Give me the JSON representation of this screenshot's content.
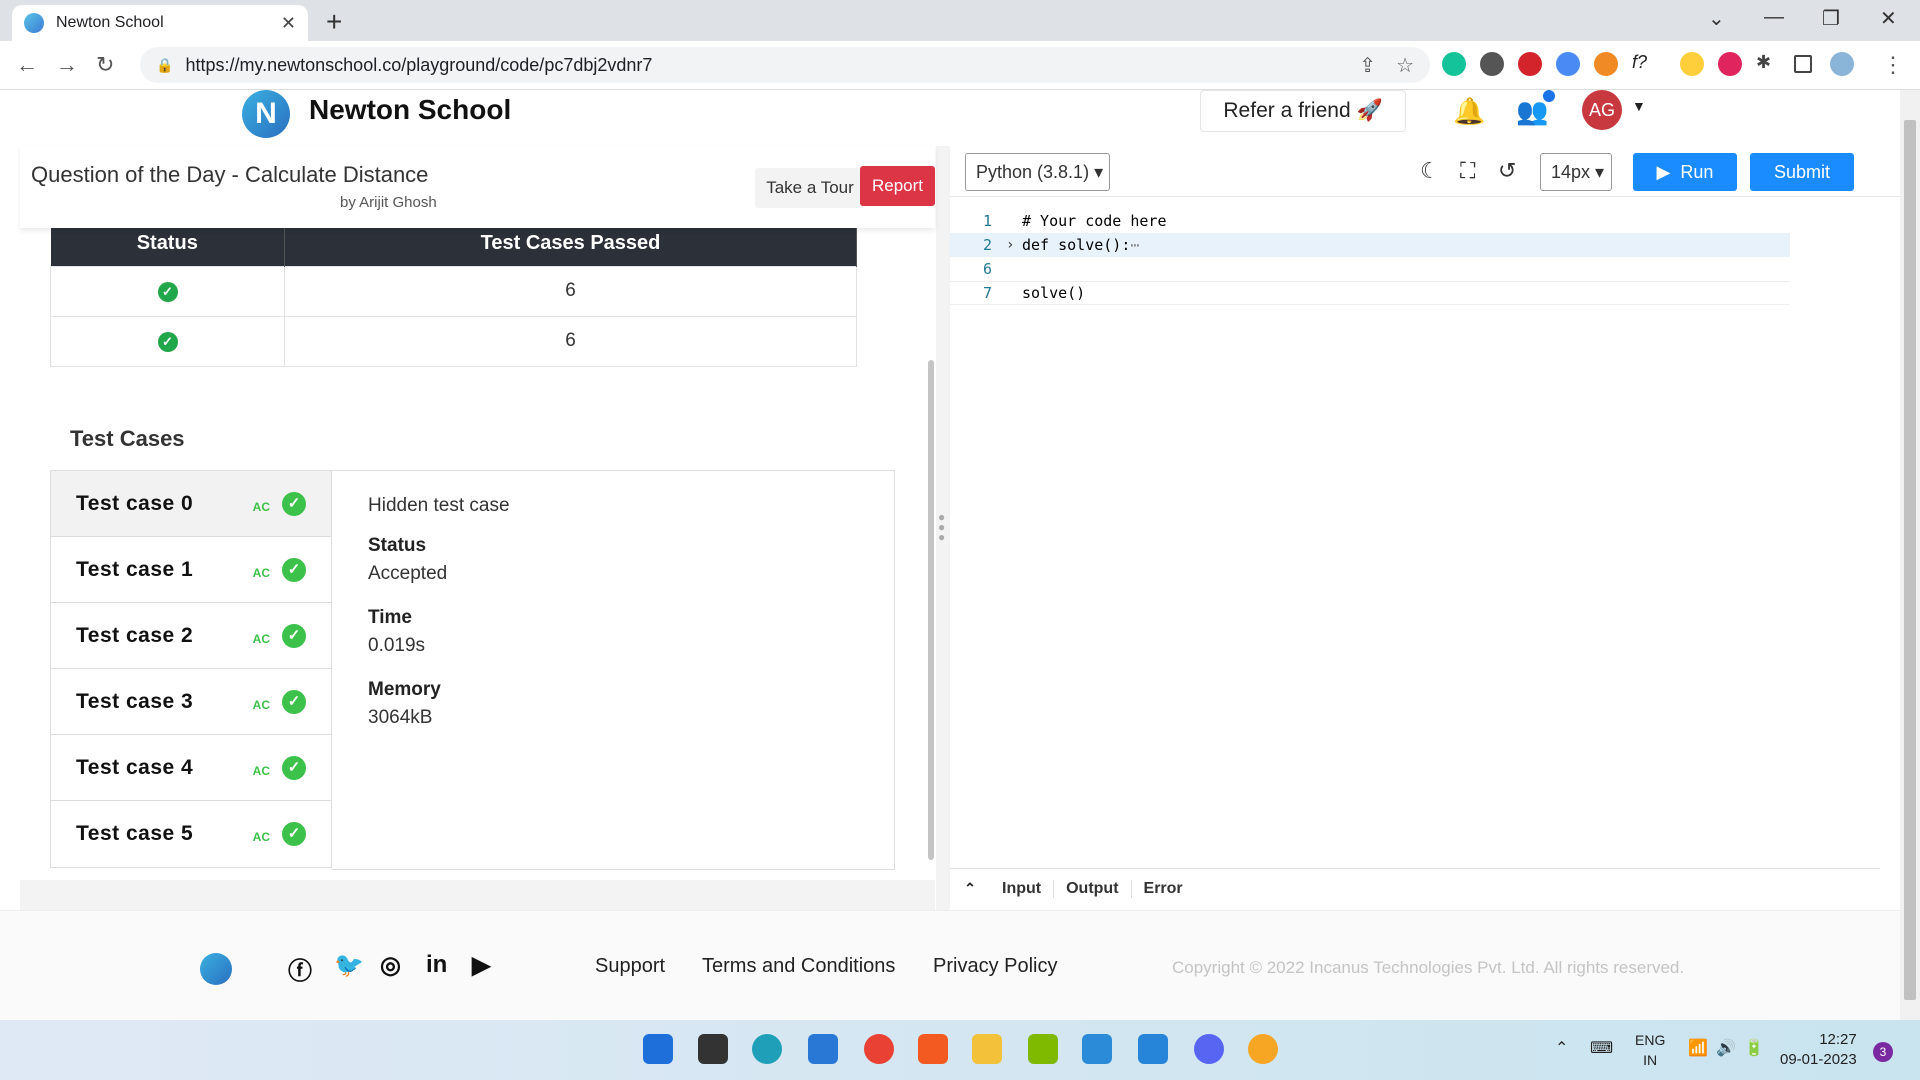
{
  "browser": {
    "tab_title": "Newton School",
    "url": "https://my.newtonschool.co/playground/code/pc7dbj2vdnr7"
  },
  "site": {
    "brand": "Newton School",
    "refer": "Refer a friend 🚀",
    "avatar": "AG"
  },
  "question": {
    "title": "Question of the Day - Calculate Distance",
    "author": "by Arijit Ghosh",
    "tour_label": "Take a Tour",
    "report_label": "Report"
  },
  "status_table": {
    "headers": [
      "Status",
      "Test Cases Passed"
    ],
    "rows": [
      {
        "status": "✓",
        "passed": "6"
      },
      {
        "status": "✓",
        "passed": "6"
      }
    ]
  },
  "test_cases": {
    "title": "Test Cases",
    "items": [
      {
        "name": "Test case 0",
        "verdict": "AC"
      },
      {
        "name": "Test case 1",
        "verdict": "AC"
      },
      {
        "name": "Test case 2",
        "verdict": "AC"
      },
      {
        "name": "Test case 3",
        "verdict": "AC"
      },
      {
        "name": "Test case 4",
        "verdict": "AC"
      },
      {
        "name": "Test case 5",
        "verdict": "AC"
      }
    ],
    "detail": {
      "hidden": "Hidden test case",
      "status_label": "Status",
      "status_value": "Accepted",
      "time_label": "Time",
      "time_value": "0.019s",
      "memory_label": "Memory",
      "memory_value": "3064kB"
    }
  },
  "editor": {
    "language": "Python (3.8.1)",
    "font_size": "14px",
    "run_label": "Run",
    "submit_label": "Submit",
    "lines": [
      {
        "num": "1",
        "text": "# Your code here"
      },
      {
        "num": "2",
        "text": "def solve():"
      },
      {
        "num": "6",
        "text": ""
      },
      {
        "num": "7",
        "text": "solve()"
      }
    ],
    "io_tabs": [
      "Input",
      "Output",
      "Error"
    ]
  },
  "footer": {
    "links": [
      "Support",
      "Terms and Conditions",
      "Privacy Policy"
    ],
    "copyright": "Copyright © 2022 Incanus Technologies Pvt. Ltd. All rights reserved."
  },
  "taskbar": {
    "lang": "ENG",
    "region": "IN",
    "time": "12:27",
    "date": "09-01-2023",
    "notifications": "3"
  },
  "colors": {
    "accent": "#1a8cff",
    "report": "#dc3545",
    "success": "#3cc14a"
  }
}
